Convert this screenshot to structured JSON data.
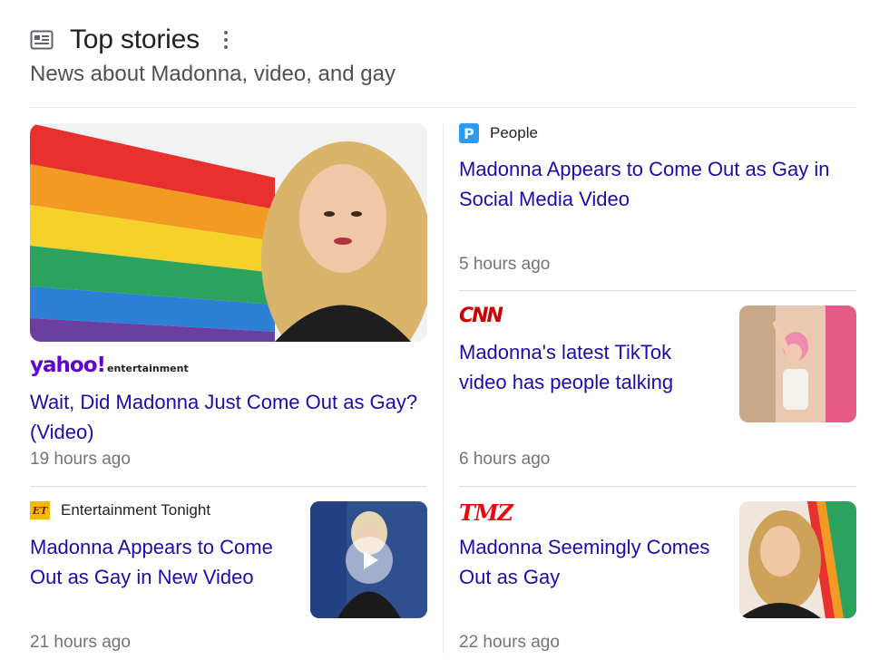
{
  "header": {
    "title": "Top stories",
    "subtitle": "News about Madonna, video, and gay",
    "icon": "newspaper-icon",
    "menu_icon": "more-vert-icon"
  },
  "stories": [
    {
      "source": "yahoo!entertainment",
      "source_logo": "yahoo-entertainment-logo",
      "headline": "Wait, Did Madonna Just Come Out as Gay? (Video)",
      "time": "19 hours ago"
    },
    {
      "source": "People",
      "source_logo": "people-logo",
      "headline": "Madonna Appears to Come Out as Gay in Social Media Video",
      "time": "5 hours ago"
    },
    {
      "source": "CNN",
      "source_logo": "cnn-logo",
      "headline": "Madonna's latest TikTok video has people talking",
      "time": "6 hours ago"
    },
    {
      "source": "Entertainment Tonight",
      "source_logo": "et-logo",
      "headline": "Madonna Appears to Come Out as Gay in New Video",
      "time": "21 hours ago"
    },
    {
      "source": "TMZ",
      "source_logo": "tmz-logo",
      "headline": "Madonna Seemingly Comes Out as Gay",
      "time": "22 hours ago"
    }
  ],
  "logos": {
    "people": "P",
    "et": "ET",
    "yahoo_word": "yahoo!",
    "yahoo_sub": "entertainment",
    "cnn": "CNN",
    "tmz": "TMZ"
  },
  "colors": {
    "link": "#1a0dab",
    "meta": "#70757a",
    "yahoo": "#6001d2",
    "cnn": "#cc0000",
    "tmz": "#e50914",
    "people": "#2b9bf4",
    "et": "#f5b700"
  }
}
